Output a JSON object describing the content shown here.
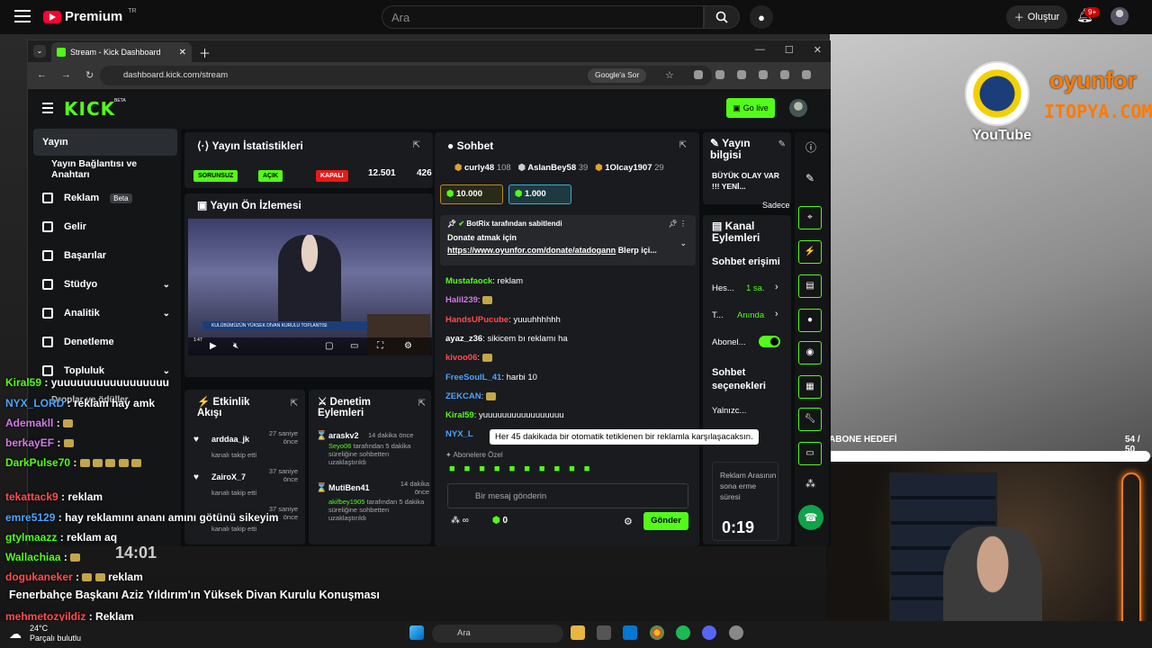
{
  "youtube": {
    "logo_text": "Premium",
    "logo_region": "TR",
    "search_placeholder": "Ara",
    "create_label": "Oluştur",
    "notification_badge": "9+"
  },
  "overlay": {
    "brand_logo_text": "YouTube",
    "sponsor_1": "oyunfor",
    "sponsor_2": "ITOPYA.COM",
    "goal_label": "ABONE HEDEFİ",
    "goal_count": "54 / 50",
    "goal_progress": 1.0,
    "video_title": "Fenerbahçe Başkanı Aziz Yıldırım'ın Yüksek Divan Kurulu Konuşması",
    "timestamp": "14:01"
  },
  "chrome": {
    "tab_title": "Stream - Kick Dashboard",
    "url": "dashboard.kick.com/stream",
    "google_button": "Google'a Sor"
  },
  "kick": {
    "logo": "KICK",
    "logo_badge": "BETA",
    "go_live": "Go live",
    "sidebar": [
      {
        "label": "Yayın",
        "active": true
      },
      {
        "label": "Yayın Bağlantısı ve Anahtarı",
        "active": false
      },
      {
        "label": "Reklam",
        "badge": "Beta"
      },
      {
        "label": "Gelir"
      },
      {
        "label": "Başarılar"
      },
      {
        "label": "Stüdyo"
      },
      {
        "label": "Analitik"
      },
      {
        "label": "Denetleme"
      },
      {
        "label": "Topluluk"
      },
      {
        "label": "Droplar ve ödüller"
      }
    ],
    "stats": {
      "title": "Yayın İstatistikleri",
      "pills": [
        "SORUNSUZ",
        "AÇIK",
        "KAPALI"
      ],
      "values": [
        "12.501",
        "426"
      ]
    },
    "preview": {
      "title": "Yayın Ön İzlemesi",
      "caption": "KULÜBÜMÜZÜN YÜKSEK DİVAN KURULU TOPLANTISI",
      "time": "1:47"
    },
    "activity": {
      "title": "Etkinlik Akışı",
      "items": [
        {
          "user": "arddaa_jk",
          "time": "27 saniye önce",
          "text": "kanalı takip etti"
        },
        {
          "user": "ZairoX_7",
          "time": "37 saniye önce",
          "text": "kanalı takip etti"
        },
        {
          "user": "",
          "time": "37 saniye önce",
          "text": "kanalı takip etti"
        }
      ]
    },
    "moderation": {
      "title": "Denetim Eylemleri",
      "items": [
        {
          "user": "araskv2",
          "time": "14 dakika önce",
          "actor": "Seyo06",
          "text": "tarafından 5 dakika süreliğine sohbetten uzaklaştırıldı"
        },
        {
          "user": "MutiBen41",
          "time": "14 dakika önce",
          "actor": "akifbey1905",
          "text": "tarafından 5 dakika süreliğine sohbetten uzaklaştırıldı"
        }
      ]
    },
    "chat": {
      "title": "Sohbet",
      "top_users": [
        {
          "name": "curly48",
          "count": "108"
        },
        {
          "name": "AslanBey58",
          "count": "39"
        },
        {
          "name": "1Olcay1907",
          "count": "29"
        }
      ],
      "gifts": [
        "10.000",
        "1.000"
      ],
      "pinned_by": "BotRix tarafından sabitlendi",
      "pinned_line1": "Donate atmak için",
      "pinned_link": "https://www.oyunfor.com/donate/atadogann",
      "pinned_rest": "Blerp içi...",
      "messages": [
        {
          "user": "Mustafaock",
          "color": "#53fc18",
          "text": "reklam"
        },
        {
          "user": "Halil239",
          "color": "#d07ae6",
          "text": ""
        },
        {
          "user": "HandsUPucube",
          "color": "#ff4d4d",
          "text": "yuuuhhhhhh"
        },
        {
          "user": "ayaz_z36",
          "color": "#ffffff",
          "text": "sikicem bı reklamı ha"
        },
        {
          "user": "kivoo06",
          "color": "#ff4d4d",
          "text": ""
        },
        {
          "user": "FreeSoulL_41",
          "color": "#4da3ff",
          "text": "harbi 10"
        },
        {
          "user": "ZEKCAN",
          "color": "#4da3ff",
          "text": ""
        },
        {
          "user": "Kiral59",
          "color": "#53fc18",
          "text": "yuuuuuuuuuuuuuuuuu"
        },
        {
          "user": "NYX_L",
          "color": "#4da3ff",
          "text": ""
        }
      ],
      "subscriber_label": "Abonelere Özel",
      "input_placeholder": "Bir mesaj gönderin",
      "points": "0",
      "send": "Gönder",
      "tooltip": "Her 45 dakikada bir otomatik tetiklenen bir reklamla karşılaşacaksın."
    },
    "stream_info": {
      "title": "Yayın bilgisi",
      "text": "BÜYÜK OLAY VAR !!! YENİ...",
      "sub": "Sadece"
    },
    "channel_actions": {
      "title": "Kanal Eylemleri",
      "chat_access": "Sohbet erişimi",
      "row1_label": "Hes...",
      "row1_value": "1 sa.",
      "row2_label": "T...",
      "row2_value": "Anında",
      "row3_label": "Abonel...",
      "options": "Sohbet seçenekleri",
      "row4_label": "Yalnızc..."
    },
    "ad_timer": {
      "label": "Reklam Arasının sona erme süresi",
      "value": "0:19"
    }
  },
  "left_chat": [
    {
      "user": "Kiral59",
      "color": "#53fc18",
      "text": "yuuuuuuuuuuuuuuuuu"
    },
    {
      "user": "NYX_LORD",
      "color": "#4da3ff",
      "text": "reklam hay amk"
    },
    {
      "user": "Ademakll",
      "color": "#d07ae6",
      "text": ""
    },
    {
      "user": "berkayEF",
      "color": "#d07ae6",
      "text": ""
    },
    {
      "user": "DarkPulse70",
      "color": "#53fc18",
      "text": ""
    },
    {
      "user": "tekattack9",
      "color": "#ff4d4d",
      "text": "reklam"
    },
    {
      "user": "emre5129",
      "color": "#4da3ff",
      "text": "hay reklamını ananı amını götünü sikeyim"
    },
    {
      "user": "gtylmaazz",
      "color": "#53fc18",
      "text": "reklam aq"
    },
    {
      "user": "Wallachiaa",
      "color": "#53fc18",
      "text": ""
    },
    {
      "user": "dogukaneker",
      "color": "#ff4d4d",
      "text": "reklam"
    },
    {
      "user": "mehmetozyildiz",
      "color": "#ff4d4d",
      "text": "Reklam"
    }
  ],
  "taskbar": {
    "temp": "24°C",
    "weather": "Parçalı bulutlu",
    "search": "Ara"
  }
}
